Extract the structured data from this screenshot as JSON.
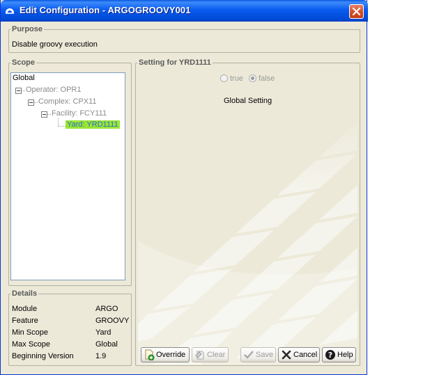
{
  "window": {
    "title": "Edit Configuration - ARGOGROOVY001"
  },
  "purpose": {
    "legend": "Purpose",
    "text": "Disable groovy execution"
  },
  "scope": {
    "legend": "Scope",
    "tree": [
      {
        "label": "Global"
      },
      {
        "label": "Operator: OPR1"
      },
      {
        "label": "Complex: CPX11"
      },
      {
        "label": "Facility: FCY111"
      },
      {
        "label": "Yard: YRD1111",
        "selected": true
      }
    ]
  },
  "details": {
    "legend": "Details",
    "rows": [
      {
        "label": "Module",
        "value": "ARGO"
      },
      {
        "label": "Feature",
        "value": "GROOVY"
      },
      {
        "label": "Min Scope",
        "value": "Yard"
      },
      {
        "label": "Max Scope",
        "value": "Global"
      },
      {
        "label": "Beginning Version",
        "value": "1.9"
      }
    ]
  },
  "setting": {
    "legend": "Setting for YRD1111",
    "options": [
      {
        "label": "true",
        "checked": false
      },
      {
        "label": "false",
        "checked": true
      }
    ],
    "status": "Global Setting"
  },
  "buttons": {
    "override": "Override",
    "clear": "Clear",
    "save": "Save",
    "cancel": "Cancel",
    "help": "Help"
  },
  "colors": {
    "titlebar": "#0a5cf0",
    "selection": "#99e633",
    "face": "#ece9d8"
  }
}
